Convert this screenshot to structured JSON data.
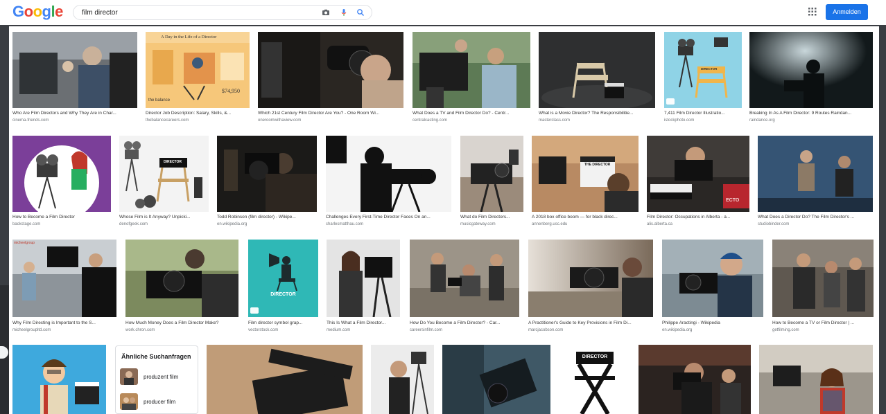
{
  "header": {
    "logo_letters": [
      "G",
      "o",
      "o",
      "g",
      "l",
      "e"
    ],
    "search_value": "film director",
    "signin_label": "Anmelden",
    "icons": [
      "camera-icon",
      "mic-icon",
      "search-icon",
      "apps-icon"
    ],
    "accent": "#1a73e8"
  },
  "rows": [
    [
      {
        "title": "Who Are Film Directors and Why They Are in Char...",
        "source": "cinema-friends.com"
      },
      {
        "title": "Director Job Description: Salary, Skills, &...",
        "source": "thebalancecareers.com"
      },
      {
        "title": "Which 21st Century Film Director Are You? - One Room Wi...",
        "source": "oneroomwithaview.com"
      },
      {
        "title": "What Does a TV and Film Director Do? - Centr...",
        "source": "centralcasting.com"
      },
      {
        "title": "What is a Movie Director? The Responsibilitie...",
        "source": "masterclass.com"
      },
      {
        "title": "7,411 Film Director Illustratio...",
        "source": "istockphoto.com"
      },
      {
        "title": "Breaking In As A Film Director: 9 Routes Raindan...",
        "source": "raindance.org"
      }
    ],
    [
      {
        "title": "How to Become a Film Director",
        "source": "backstage.com"
      },
      {
        "title": "Whose Film is It Anyway? Unpicki...",
        "source": "denofgeek.com"
      },
      {
        "title": "Todd Robinson (film director) - Wikipe...",
        "source": "en.wikipedia.org"
      },
      {
        "title": "Challenges Every First-Time Director Faces On an...",
        "source": "charlesmatthau.com"
      },
      {
        "title": "What do Film Directors...",
        "source": "musicgateway.com"
      },
      {
        "title": "A 2018 box office boom — for black direc...",
        "source": "annenberg.usc.edu"
      },
      {
        "title": "Film Director: Occupations in Alberta - a...",
        "source": "alis.alberta.ca"
      },
      {
        "title": "What Does a Director Do? The Film Director's ...",
        "source": "studiobinder.com"
      }
    ],
    [
      {
        "title": "Why Film Directing is Important to the S...",
        "source": "micheelgroupltd.com"
      },
      {
        "title": "How Much Money Does a Film Director Make?",
        "source": "work.chron.com"
      },
      {
        "title": "Film director symbol grap...",
        "source": "vectorstock.com"
      },
      {
        "title": "This Is What a Film Director...",
        "source": "medium.com"
      },
      {
        "title": "How Do You Become a Film Director? - Car...",
        "source": "careersinfilm.com"
      },
      {
        "title": "A Practitioner's Guide to Key Provisions in Film Di...",
        "source": "marcjacobson.com"
      },
      {
        "title": "Philippe Aractingi - Wikipedia",
        "source": "en.wikipedia.org"
      },
      {
        "title": "How to Become a TV or Film Director | ...",
        "source": "getfilming.com"
      }
    ]
  ],
  "image_text": {
    "day_in_life": "A Day in the Life of a Director",
    "salary": "$74,950",
    "balance": "the balance",
    "director_chair": "DIRECTOR",
    "clap_the_director": "THE DIRECTOR",
    "ecto": "ECTO",
    "micheel": "micheelgroup",
    "director_symbol": "DIRECTOR",
    "director_chair_bottom": "DIRECTOR"
  },
  "related": {
    "title": "Ähnliche Suchanfragen",
    "items": [
      {
        "label": "produzent film"
      },
      {
        "label": "producer film"
      }
    ]
  }
}
